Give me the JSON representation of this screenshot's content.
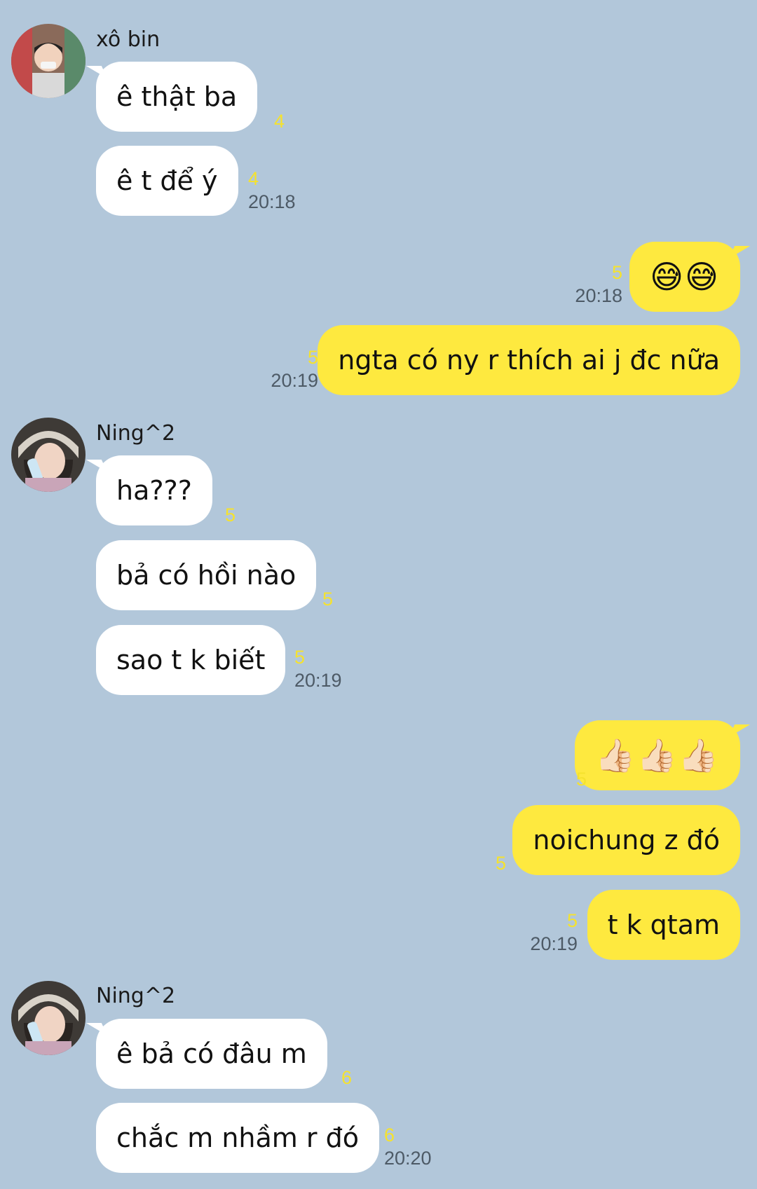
{
  "colors": {
    "background": "#b2c7da",
    "incoming_bubble": "#ffffff",
    "outgoing_bubble": "#fee93f",
    "unread_count": "#f5e22e",
    "timestamp": "#4d5a66"
  },
  "groups": [
    {
      "sender": "xô bin",
      "avatar_icon": "user-photo-avatar",
      "messages": [
        {
          "text": "ê thật ba",
          "count": "4",
          "time": ""
        },
        {
          "text": "ê t để ý",
          "count": "4",
          "time": "20:18"
        }
      ]
    },
    {
      "sender": "me",
      "messages": [
        {
          "text": "😅😅",
          "count": "5",
          "time": "20:18"
        },
        {
          "text": "ngta có ny r thích ai j đc nữa",
          "count": "5",
          "time": "20:19"
        }
      ]
    },
    {
      "sender": "Ning^2",
      "avatar_icon": "user-photo-avatar",
      "messages": [
        {
          "text": "ha???",
          "count": "5",
          "time": ""
        },
        {
          "text": "bả có hồi nào",
          "count": "5",
          "time": ""
        },
        {
          "text": "sao t k biết",
          "count": "5",
          "time": "20:19"
        }
      ]
    },
    {
      "sender": "me",
      "messages": [
        {
          "text": "👍🏻👍🏻👍🏻",
          "count": "5",
          "time": ""
        },
        {
          "text": "noichung z đó",
          "count": "5",
          "time": ""
        },
        {
          "text": "t k qtam",
          "count": "5",
          "time": "20:19"
        }
      ]
    },
    {
      "sender": "Ning^2",
      "avatar_icon": "user-photo-avatar",
      "messages": [
        {
          "text": "ê bả có đâu m",
          "count": "6",
          "time": ""
        },
        {
          "text": "chắc m nhầm r đó",
          "count": "6",
          "time": "20:20"
        }
      ]
    }
  ]
}
